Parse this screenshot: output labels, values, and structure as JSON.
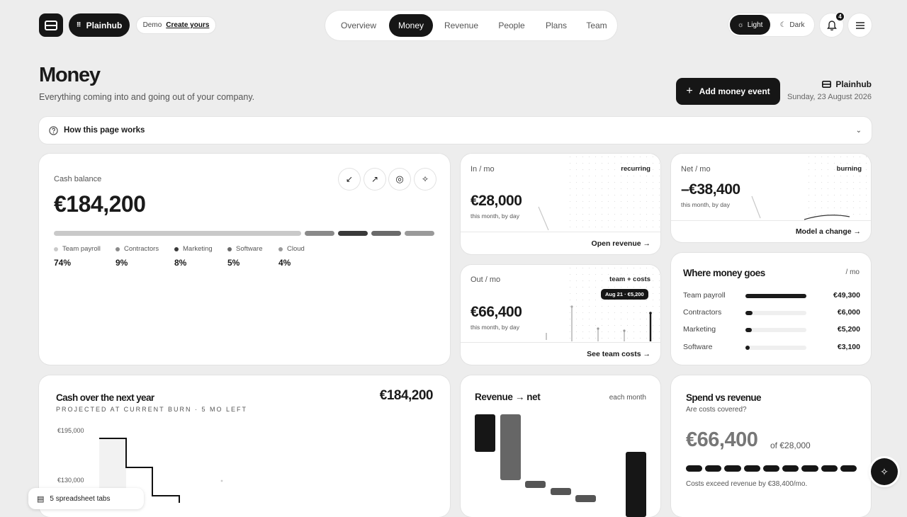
{
  "header": {
    "brand": "Plainhub",
    "demo_label": "Demo",
    "demo_link": "Create yours",
    "nav": [
      "Overview",
      "Money",
      "Revenue",
      "People",
      "Plans",
      "Team"
    ],
    "nav_active": "Money",
    "theme_light": "Light",
    "theme_dark": "Dark",
    "notifications": "4"
  },
  "page": {
    "title": "Money",
    "subtitle": "Everything coming into and going out of your company.",
    "add_button": "Add money event",
    "brand": "Plainhub",
    "date": "Sunday, 23 August 2026",
    "howto": "How this page works"
  },
  "cash": {
    "label": "Cash balance",
    "value": "€184,200",
    "breakdown": [
      {
        "name": "Team payroll",
        "pct": "74%",
        "share": 74,
        "color": "#c9c9c9"
      },
      {
        "name": "Contractors",
        "pct": "9%",
        "share": 9,
        "color": "#8a8a8a"
      },
      {
        "name": "Marketing",
        "pct": "8%",
        "share": 8,
        "color": "#3a3a3a"
      },
      {
        "name": "Software",
        "pct": "5%",
        "share": 5,
        "color": "#6a6a6a"
      },
      {
        "name": "Cloud",
        "pct": "4%",
        "share": 4,
        "color": "#9a9a9a"
      }
    ]
  },
  "in": {
    "label": "In / mo",
    "tag": "recurring",
    "value": "€28,000",
    "sub": "this month, by day",
    "link": "Open revenue →"
  },
  "net": {
    "label": "Net / mo",
    "tag": "burning",
    "value": "–€38,400",
    "sub": "this month, by day",
    "link": "Model a change →"
  },
  "out": {
    "label": "Out / mo",
    "tag": "team + costs",
    "tooltip": "Aug 21 · €5,200",
    "value": "€66,400",
    "sub": "this month, by day",
    "link": "See team costs →"
  },
  "where": {
    "title": "Where money goes",
    "unit": "/ mo",
    "rows": [
      {
        "name": "Team payroll",
        "value": "€49,300",
        "share": 1.0
      },
      {
        "name": "Contractors",
        "value": "€6,000",
        "share": 0.12
      },
      {
        "name": "Marketing",
        "value": "€5,200",
        "share": 0.11
      },
      {
        "name": "Software",
        "value": "€3,100",
        "share": 0.06
      }
    ]
  },
  "projection": {
    "title": "Cash over the next year",
    "subtitle": "PROJECTED AT CURRENT BURN · 5 MO LEFT",
    "value": "€184,200",
    "y_top": "€195,000",
    "y_mid": "€130,000"
  },
  "revnet": {
    "title": "Revenue → net",
    "unit": "each month"
  },
  "spend": {
    "title": "Spend vs revenue",
    "question": "Are costs covered?",
    "value": "€66,400",
    "of": "of €28,000",
    "note": "Costs exceed revenue by €38,400/mo."
  },
  "toast": "5 spreadsheet tabs"
}
